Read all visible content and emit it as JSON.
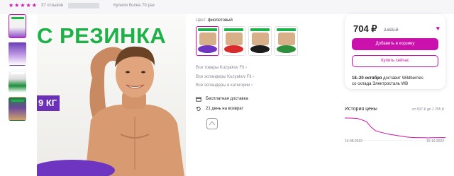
{
  "top": {
    "rating_stars": 5,
    "reviews": "37 отзывов",
    "bought": "Купили более 70 раз"
  },
  "main_image": {
    "banner_text": "С РЕЗИНКА",
    "weight_badge": "9 КГ"
  },
  "product": {
    "color_label": "Цвет:",
    "color_value": "фиолетовый",
    "links": [
      "Все товары Kuzyakov Fit",
      "Все эспандеры Kuzyakov Fit",
      "Все эспандеры в категории"
    ],
    "features": [
      "Бесплатная доставка",
      "21 день на возврат"
    ]
  },
  "buy": {
    "price": "704 ₽",
    "old_price": "2 800 ₽",
    "add_to_cart": "Добавить в корзину",
    "buy_now": "Купить сейчас",
    "delivery_date": "18–20 октября",
    "delivery_text": "доставит Wildberries",
    "delivery_from": "со склада Электросталь WB"
  },
  "price_history": {
    "title": "История цены",
    "range": "от 697 ₽ до 1 255 ₽",
    "date_start": "14.08.2022",
    "date_end": "15.10.2022"
  },
  "colors": {
    "accent": "#cb11ab",
    "brand_green": "#1eb147",
    "band_purple": "#6e35c0"
  },
  "chart_data": {
    "type": "line",
    "x": [
      "14.08.2022",
      "15.10.2022"
    ],
    "series": [
      {
        "values": [
          1255,
          1255,
          1250,
          1240,
          1200,
          1150,
          1000,
          900,
          860,
          830,
          800,
          780,
          760,
          740,
          720,
          710,
          705,
          700,
          700,
          697,
          700,
          702,
          704,
          704
        ]
      }
    ],
    "ylim": [
      697,
      1255
    ]
  }
}
